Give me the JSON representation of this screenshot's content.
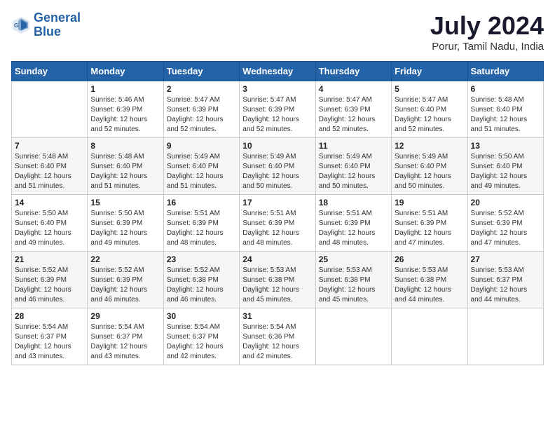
{
  "header": {
    "logo_line1": "General",
    "logo_line2": "Blue",
    "title": "July 2024",
    "subtitle": "Porur, Tamil Nadu, India"
  },
  "columns": [
    "Sunday",
    "Monday",
    "Tuesday",
    "Wednesday",
    "Thursday",
    "Friday",
    "Saturday"
  ],
  "weeks": [
    [
      {
        "day": "",
        "detail": ""
      },
      {
        "day": "1",
        "detail": "Sunrise: 5:46 AM\nSunset: 6:39 PM\nDaylight: 12 hours\nand 52 minutes."
      },
      {
        "day": "2",
        "detail": "Sunrise: 5:47 AM\nSunset: 6:39 PM\nDaylight: 12 hours\nand 52 minutes."
      },
      {
        "day": "3",
        "detail": "Sunrise: 5:47 AM\nSunset: 6:39 PM\nDaylight: 12 hours\nand 52 minutes."
      },
      {
        "day": "4",
        "detail": "Sunrise: 5:47 AM\nSunset: 6:39 PM\nDaylight: 12 hours\nand 52 minutes."
      },
      {
        "day": "5",
        "detail": "Sunrise: 5:47 AM\nSunset: 6:40 PM\nDaylight: 12 hours\nand 52 minutes."
      },
      {
        "day": "6",
        "detail": "Sunrise: 5:48 AM\nSunset: 6:40 PM\nDaylight: 12 hours\nand 51 minutes."
      }
    ],
    [
      {
        "day": "7",
        "detail": "Sunrise: 5:48 AM\nSunset: 6:40 PM\nDaylight: 12 hours\nand 51 minutes."
      },
      {
        "day": "8",
        "detail": "Sunrise: 5:48 AM\nSunset: 6:40 PM\nDaylight: 12 hours\nand 51 minutes."
      },
      {
        "day": "9",
        "detail": "Sunrise: 5:49 AM\nSunset: 6:40 PM\nDaylight: 12 hours\nand 51 minutes."
      },
      {
        "day": "10",
        "detail": "Sunrise: 5:49 AM\nSunset: 6:40 PM\nDaylight: 12 hours\nand 50 minutes."
      },
      {
        "day": "11",
        "detail": "Sunrise: 5:49 AM\nSunset: 6:40 PM\nDaylight: 12 hours\nand 50 minutes."
      },
      {
        "day": "12",
        "detail": "Sunrise: 5:49 AM\nSunset: 6:40 PM\nDaylight: 12 hours\nand 50 minutes."
      },
      {
        "day": "13",
        "detail": "Sunrise: 5:50 AM\nSunset: 6:40 PM\nDaylight: 12 hours\nand 49 minutes."
      }
    ],
    [
      {
        "day": "14",
        "detail": "Sunrise: 5:50 AM\nSunset: 6:40 PM\nDaylight: 12 hours\nand 49 minutes."
      },
      {
        "day": "15",
        "detail": "Sunrise: 5:50 AM\nSunset: 6:39 PM\nDaylight: 12 hours\nand 49 minutes."
      },
      {
        "day": "16",
        "detail": "Sunrise: 5:51 AM\nSunset: 6:39 PM\nDaylight: 12 hours\nand 48 minutes."
      },
      {
        "day": "17",
        "detail": "Sunrise: 5:51 AM\nSunset: 6:39 PM\nDaylight: 12 hours\nand 48 minutes."
      },
      {
        "day": "18",
        "detail": "Sunrise: 5:51 AM\nSunset: 6:39 PM\nDaylight: 12 hours\nand 48 minutes."
      },
      {
        "day": "19",
        "detail": "Sunrise: 5:51 AM\nSunset: 6:39 PM\nDaylight: 12 hours\nand 47 minutes."
      },
      {
        "day": "20",
        "detail": "Sunrise: 5:52 AM\nSunset: 6:39 PM\nDaylight: 12 hours\nand 47 minutes."
      }
    ],
    [
      {
        "day": "21",
        "detail": "Sunrise: 5:52 AM\nSunset: 6:39 PM\nDaylight: 12 hours\nand 46 minutes."
      },
      {
        "day": "22",
        "detail": "Sunrise: 5:52 AM\nSunset: 6:39 PM\nDaylight: 12 hours\nand 46 minutes."
      },
      {
        "day": "23",
        "detail": "Sunrise: 5:52 AM\nSunset: 6:38 PM\nDaylight: 12 hours\nand 46 minutes."
      },
      {
        "day": "24",
        "detail": "Sunrise: 5:53 AM\nSunset: 6:38 PM\nDaylight: 12 hours\nand 45 minutes."
      },
      {
        "day": "25",
        "detail": "Sunrise: 5:53 AM\nSunset: 6:38 PM\nDaylight: 12 hours\nand 45 minutes."
      },
      {
        "day": "26",
        "detail": "Sunrise: 5:53 AM\nSunset: 6:38 PM\nDaylight: 12 hours\nand 44 minutes."
      },
      {
        "day": "27",
        "detail": "Sunrise: 5:53 AM\nSunset: 6:37 PM\nDaylight: 12 hours\nand 44 minutes."
      }
    ],
    [
      {
        "day": "28",
        "detail": "Sunrise: 5:54 AM\nSunset: 6:37 PM\nDaylight: 12 hours\nand 43 minutes."
      },
      {
        "day": "29",
        "detail": "Sunrise: 5:54 AM\nSunset: 6:37 PM\nDaylight: 12 hours\nand 43 minutes."
      },
      {
        "day": "30",
        "detail": "Sunrise: 5:54 AM\nSunset: 6:37 PM\nDaylight: 12 hours\nand 42 minutes."
      },
      {
        "day": "31",
        "detail": "Sunrise: 5:54 AM\nSunset: 6:36 PM\nDaylight: 12 hours\nand 42 minutes."
      },
      {
        "day": "",
        "detail": ""
      },
      {
        "day": "",
        "detail": ""
      },
      {
        "day": "",
        "detail": ""
      }
    ]
  ]
}
